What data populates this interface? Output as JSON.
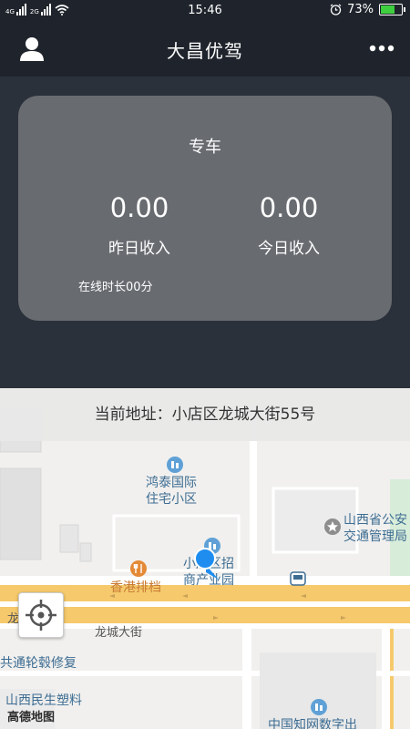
{
  "status_bar": {
    "signal1_label": "4G",
    "signal2_label": "2G",
    "time": "15:46",
    "battery_percent": "73%",
    "battery_level": 0.73
  },
  "header": {
    "title": "大昌优驾"
  },
  "card": {
    "title": "专车",
    "yesterday_value": "0.00",
    "yesterday_label": "昨日收入",
    "today_value": "0.00",
    "today_label": "今日收入",
    "online_time": "在线时长00分"
  },
  "map": {
    "address": "当前地址：小店区龙城大街55号",
    "pois": {
      "hongtai_line1": "鸿泰国际",
      "hongtai_line2": "住宅小区",
      "police_line1": "山西省公安",
      "police_line2": "交通管理局",
      "xiaodian_line1": "小店区招",
      "xiaodian_line2": "商产业园",
      "hk": "香港排档",
      "lunggu": "共通轮毂修复",
      "minsheng": "山西民生塑料",
      "zhongguo": "中国知网数字出"
    },
    "roads": {
      "road1": "龙城大街",
      "road2": "龙城大街"
    },
    "logo_text": "高德地图"
  },
  "colors": {
    "background": "#1f242c",
    "card": "#686b70",
    "header_panel": "#2b313a",
    "location_dot": "#1f8df0",
    "battery": "#3ecf3e"
  },
  "icons": [
    "user-icon",
    "more-icon",
    "locate-icon",
    "alarm-icon",
    "battery-icon",
    "wifi-icon",
    "bank-icon",
    "star-icon",
    "bus-icon",
    "restaurant-icon"
  ]
}
